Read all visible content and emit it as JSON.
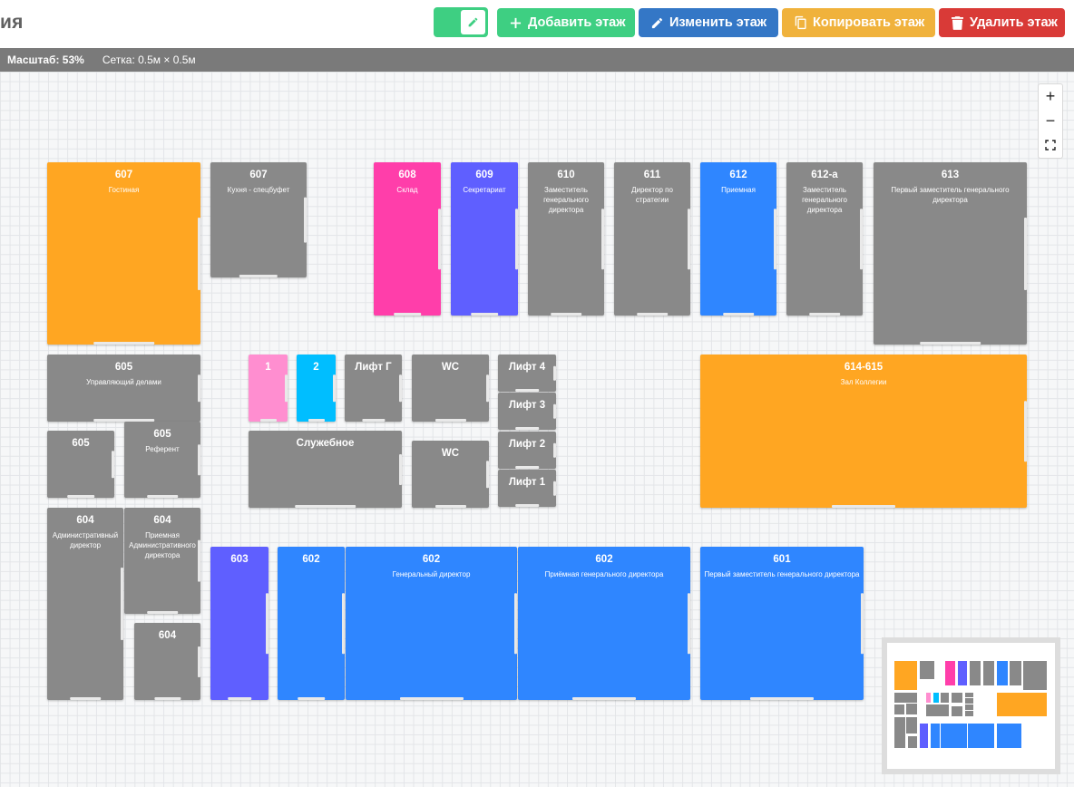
{
  "header": {
    "title": "ия",
    "buttons": {
      "add": "Добавить этаж",
      "edit": "Изменить этаж",
      "copy": "Копировать этаж",
      "delete": "Удалить этаж"
    }
  },
  "statusbar": {
    "scale": "Масштаб: 53%",
    "grid": "Сетка: 0.5м × 0.5м"
  },
  "zoom": {
    "in": "+",
    "out": "−",
    "fit": "⛶"
  },
  "colors": {
    "gray": "#898989",
    "orange": "#ffa622",
    "magenta": "#ff3eaa",
    "violet": "#5f5fff",
    "blue": "#2f86ff",
    "pink": "#ff8ed0",
    "cyan": "#00beff"
  },
  "rooms": [
    {
      "number": "607",
      "name": "Гостиная",
      "color": "orange"
    },
    {
      "number": "607",
      "name": "Кухня - спецбуфет",
      "color": "gray"
    },
    {
      "number": "608",
      "name": "Склад",
      "color": "magenta"
    },
    {
      "number": "609",
      "name": "Секретариат",
      "color": "violet"
    },
    {
      "number": "610",
      "name": "Заместитель генерального директора",
      "color": "gray"
    },
    {
      "number": "611",
      "name": "Директор по стратегии",
      "color": "gray"
    },
    {
      "number": "612",
      "name": "Приемная",
      "color": "blue"
    },
    {
      "number": "612-а",
      "name": "Заместитель генерального директора",
      "color": "gray"
    },
    {
      "number": "613",
      "name": "Первый заместитель генерального директора",
      "color": "gray"
    },
    {
      "number": "605",
      "name": "Управляющий делами",
      "color": "gray"
    },
    {
      "number": "1",
      "name": "",
      "color": "pink"
    },
    {
      "number": "2",
      "name": "",
      "color": "cyan"
    },
    {
      "number": "Лифт Г",
      "name": "",
      "color": "gray"
    },
    {
      "number": "WC",
      "name": "",
      "color": "gray"
    },
    {
      "number": "Лифт 4",
      "name": "",
      "color": "gray"
    },
    {
      "number": "Лифт 3",
      "name": "",
      "color": "gray"
    },
    {
      "number": "Лифт 2",
      "name": "",
      "color": "gray"
    },
    {
      "number": "Лифт 1",
      "name": "",
      "color": "gray"
    },
    {
      "number": "614-615",
      "name": "Зал Коллегии",
      "color": "orange"
    },
    {
      "number": "605",
      "name": "",
      "color": "gray"
    },
    {
      "number": "605",
      "name": "Референт",
      "color": "gray"
    },
    {
      "number": "Служебное",
      "name": "",
      "color": "gray"
    },
    {
      "number": "WC",
      "name": "",
      "color": "gray"
    },
    {
      "number": "604",
      "name": "Административный директор",
      "color": "gray"
    },
    {
      "number": "604",
      "name": "Приемная Административного директора",
      "color": "gray"
    },
    {
      "number": "604",
      "name": "",
      "color": "gray"
    },
    {
      "number": "603",
      "name": "",
      "color": "violet"
    },
    {
      "number": "602",
      "name": "",
      "color": "blue"
    },
    {
      "number": "602",
      "name": "Генеральный директор",
      "color": "blue"
    },
    {
      "number": "602",
      "name": "Приёмная генерального директора",
      "color": "blue"
    },
    {
      "number": "601",
      "name": "Первый заместитель генерального директора",
      "color": "blue"
    }
  ]
}
